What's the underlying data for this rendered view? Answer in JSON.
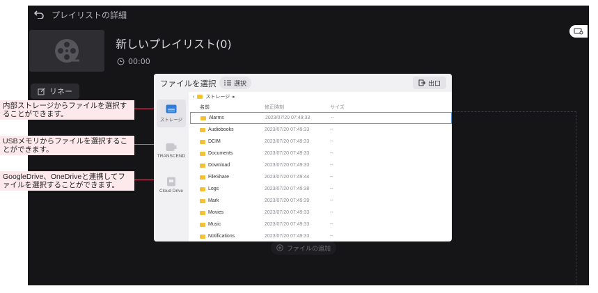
{
  "app": {
    "title": "プレイリストの詳細",
    "playlist_name": "新しいプレイリスト(0)",
    "duration": "00:00",
    "rename_label": "リネー",
    "add_file_label": "ファイルの追加"
  },
  "callouts": [
    {
      "text": "内部ストレージからファイルを選択することができます。"
    },
    {
      "text": "USBメモリからファイルを選択することができます。"
    },
    {
      "text": "GoogleDrive、OneDriveと連携してファイルを選択することができます。"
    }
  ],
  "dialog": {
    "title": "ファイルを選択",
    "select_label": "選択",
    "exit_label": "出口",
    "breadcrumb": "ストレージ",
    "sources": [
      {
        "label": "ストレージ",
        "icon": "storage-icon"
      },
      {
        "label": "TRANSCEND",
        "icon": "usb-icon"
      },
      {
        "label": "Cloud Drive",
        "icon": "cloud-drive-icon"
      }
    ],
    "columns": {
      "name": "名前",
      "date": "修正時刻",
      "size": "サイズ"
    },
    "rows": [
      {
        "name": "Alarms",
        "date": "2023/07/20 07:49:33",
        "size": "--"
      },
      {
        "name": "Audiobooks",
        "date": "2023/07/20 07:49:33",
        "size": "--"
      },
      {
        "name": "DCIM",
        "date": "2023/07/20 07:49:33",
        "size": "--"
      },
      {
        "name": "Documents",
        "date": "2023/07/20 07:49:33",
        "size": "--"
      },
      {
        "name": "Download",
        "date": "2023/07/20 07:49:33",
        "size": "--"
      },
      {
        "name": "FileShare",
        "date": "2023/07/20 07:49:44",
        "size": "--"
      },
      {
        "name": "Logs",
        "date": "2023/07/20 07:49:38",
        "size": "--"
      },
      {
        "name": "Mark",
        "date": "2023/07/20 07:49:39",
        "size": "--"
      },
      {
        "name": "Movies",
        "date": "2023/07/20 07:49:33",
        "size": "--"
      },
      {
        "name": "Music",
        "date": "2023/07/20 07:49:33",
        "size": "--"
      },
      {
        "name": "Notifications",
        "date": "2023/07/20 07:49:33",
        "size": "--"
      }
    ]
  }
}
